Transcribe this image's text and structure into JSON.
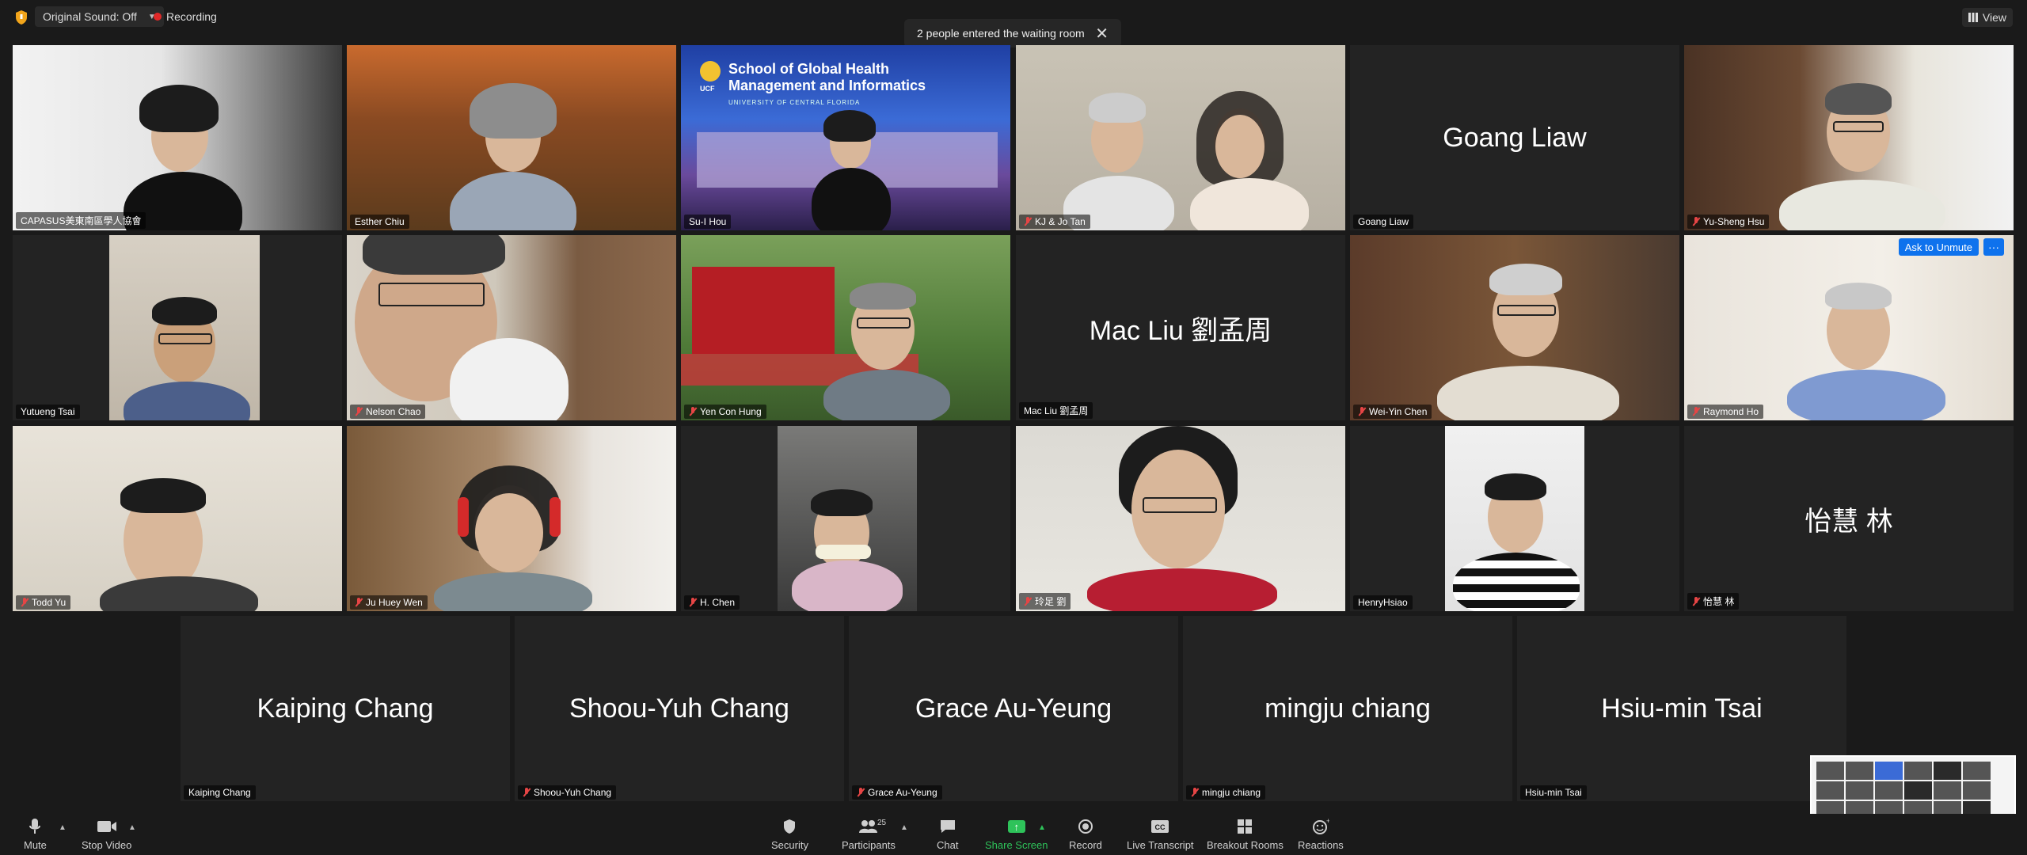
{
  "topbar": {
    "original_sound": "Original Sound: Off",
    "recording": "Recording",
    "toast": "2 people entered the waiting room",
    "view": "View"
  },
  "ucf": {
    "logo": "UCF",
    "title_line1": "School of Global Health",
    "title_line2": "Management and Informatics",
    "subtitle": "UNIVERSITY OF CENTRAL FLORIDA"
  },
  "tiles": [
    {
      "name": "CAPASUS美東南區學人協會",
      "muted": false
    },
    {
      "name": "Esther Chiu",
      "muted": false
    },
    {
      "name": "Su-I Hou",
      "muted": false
    },
    {
      "name": "KJ & Jo Tan",
      "muted": true
    },
    {
      "name": "Goang Liaw",
      "big": "Goang Liaw",
      "muted": false
    },
    {
      "name": "Yu-Sheng Hsu",
      "muted": true
    },
    {
      "name": "Yutueng Tsai",
      "muted": false
    },
    {
      "name": "Nelson Chao",
      "muted": true
    },
    {
      "name": "Yen Con Hung",
      "muted": true
    },
    {
      "name": "Mac Liu 劉孟周",
      "big": "Mac Liu 劉孟周",
      "muted": false
    },
    {
      "name": "Wei-Yin Chen",
      "muted": true
    },
    {
      "name": "Raymond Ho",
      "muted": true
    },
    {
      "name": "Todd Yu",
      "muted": true
    },
    {
      "name": "Ju Huey Wen",
      "muted": true
    },
    {
      "name": "H. Chen",
      "muted": true
    },
    {
      "name": "玲足 劉",
      "muted": true
    },
    {
      "name": "HenryHsiao",
      "muted": false
    },
    {
      "name": "怡慧 林",
      "big": "怡慧 林",
      "muted": true
    },
    {
      "name": "Kaiping Chang",
      "big": "Kaiping Chang",
      "muted": false
    },
    {
      "name": "Shoou-Yuh Chang",
      "big": "Shoou-Yuh Chang",
      "muted": true
    },
    {
      "name": "Grace Au-Yeung",
      "big": "Grace Au-Yeung",
      "muted": true
    },
    {
      "name": "mingju chiang",
      "big": "mingju chiang",
      "muted": true
    },
    {
      "name": "Hsiu-min Tsai",
      "big": "Hsiu-min Tsai",
      "muted": false
    }
  ],
  "overlay": {
    "ask_unmute": "Ask to Unmute",
    "more": "···"
  },
  "toolbar": {
    "mute": "Mute",
    "stop_video": "Stop Video",
    "security": "Security",
    "participants": "Participants",
    "participants_count": "25",
    "chat": "Chat",
    "share_screen": "Share Screen",
    "record": "Record",
    "live_transcript": "Live Transcript",
    "breakout_rooms": "Breakout Rooms",
    "reactions": "Reactions"
  },
  "icons": [
    "shield-icon",
    "caret-down-icon",
    "record-dot-icon",
    "close-icon",
    "grid-view-icon",
    "mic-icon",
    "video-camera-icon",
    "participants-icon",
    "chat-bubble-icon",
    "share-arrow-icon",
    "record-circle-icon",
    "cc-icon",
    "breakout-rooms-icon",
    "reaction-emoji-icon",
    "mic-off-icon"
  ]
}
